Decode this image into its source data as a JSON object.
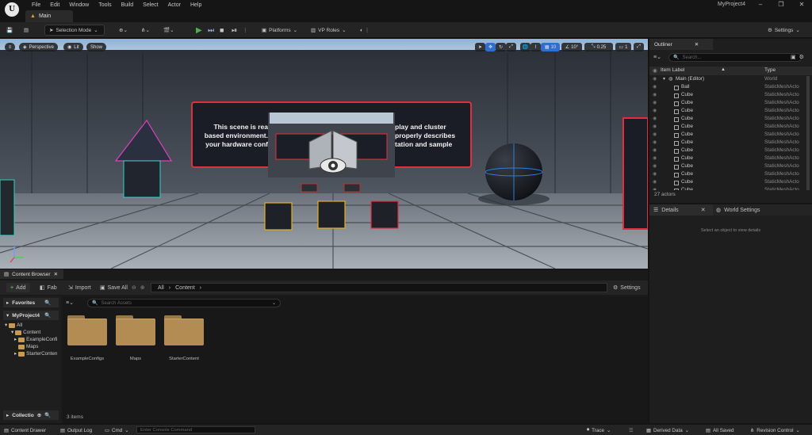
{
  "app": {
    "logo": "U",
    "menu": [
      "File",
      "Edit",
      "Window",
      "Tools",
      "Build",
      "Select",
      "Actor",
      "Help"
    ],
    "project": "MyProject4",
    "tab": "Main",
    "window_controls": [
      "–",
      "❐",
      "✕"
    ]
  },
  "toolbar": {
    "mode": "Selection Mode",
    "platforms": "Platforms",
    "vp_roles": "VP Roles",
    "settings": "Settings"
  },
  "viewport": {
    "perspective": "Perspective",
    "lit": "Lit",
    "show": "Show",
    "grid_value": "10",
    "angle_value": "10°",
    "scale_value": "0.25",
    "camera_value": "1",
    "scene_text": [
      "This scene is rea",
      "based environment.",
      "your hardware conf"
    ],
    "scene_text_right": [
      "play and cluster",
      "properly describes",
      "tation and sample"
    ]
  },
  "outliner": {
    "title": "Outliner",
    "search_placeholder": "Search...",
    "col_label": "Item Label",
    "col_type": "Type",
    "world_row": {
      "label": "Main (Editor)",
      "type": "World"
    },
    "rows": [
      {
        "label": "Ball",
        "type": "StaticMeshActo"
      },
      {
        "label": "Cube",
        "type": "StaticMeshActo"
      },
      {
        "label": "Cube",
        "type": "StaticMeshActo"
      },
      {
        "label": "Cube",
        "type": "StaticMeshActo"
      },
      {
        "label": "Cube",
        "type": "StaticMeshActo"
      },
      {
        "label": "Cube",
        "type": "StaticMeshActo"
      },
      {
        "label": "Cube",
        "type": "StaticMeshActo"
      },
      {
        "label": "Cube",
        "type": "StaticMeshActo"
      },
      {
        "label": "Cube",
        "type": "StaticMeshActo"
      },
      {
        "label": "Cube",
        "type": "StaticMeshActo"
      },
      {
        "label": "Cube",
        "type": "StaticMeshActo"
      },
      {
        "label": "Cube",
        "type": "StaticMeshActo"
      },
      {
        "label": "Cube",
        "type": "StaticMeshActo"
      },
      {
        "label": "Cube",
        "type": "StaticMeshActo"
      }
    ],
    "actor_count": "27 actors"
  },
  "details": {
    "tab_details": "Details",
    "tab_world": "World Settings",
    "empty": "Select an object to view details"
  },
  "content_browser": {
    "title": "Content Browser",
    "add": "Add",
    "fab": "Fab",
    "import": "Import",
    "save_all": "Save All",
    "path": [
      "All",
      "Content"
    ],
    "settings": "Settings",
    "search_placeholder": "Search Assets",
    "favorites": "Favorites",
    "project": "MyProject4",
    "tree": [
      "All",
      "Content",
      "ExampleConfi",
      "Maps",
      "StarterConten"
    ],
    "collections": "Collectio",
    "folders": [
      "ExampleConfigs",
      "Maps",
      "StarterContent"
    ],
    "item_count": "3 items"
  },
  "statusbar": {
    "content_drawer": "Content Drawer",
    "output_log": "Output Log",
    "cmd": "Cmd",
    "console_placeholder": "Enter Console Command",
    "trace": "Trace",
    "derived_data": "Derived Data",
    "all_saved": "All Saved",
    "revision_control": "Revision Control"
  }
}
